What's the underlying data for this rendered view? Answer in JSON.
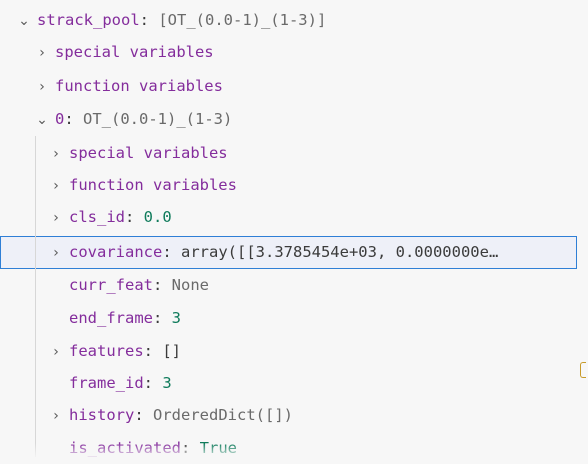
{
  "tree": {
    "root": {
      "name": "strack_pool",
      "value": "[OT_(0.0-1)_(1-3)]",
      "chevron": "chevron-down-icon"
    },
    "root_children": [
      {
        "label": "special variables",
        "chevron": "chevron-right-icon"
      },
      {
        "label": "function variables",
        "chevron": "chevron-right-icon"
      }
    ],
    "item0": {
      "name": "0",
      "value": "OT_(0.0-1)_(1-3)",
      "chevron": "chevron-down-icon"
    },
    "item0_children": [
      {
        "label": "special variables",
        "chevron": "chevron-right-icon"
      },
      {
        "label": "function variables",
        "chevron": "chevron-right-icon"
      },
      {
        "name": "cls_id",
        "value": "0.0",
        "kind": "number",
        "expandable": true
      },
      {
        "name": "covariance",
        "value": "array([[3.3785454e+03, 0.0000000e…",
        "kind": "plain",
        "expandable": true,
        "selected": true
      },
      {
        "name": "curr_feat",
        "value": "None",
        "kind": "string",
        "expandable": false
      },
      {
        "name": "end_frame",
        "value": "3",
        "kind": "number",
        "expandable": false
      },
      {
        "name": "features",
        "value": "[]",
        "kind": "plain",
        "expandable": true
      },
      {
        "name": "frame_id",
        "value": "3",
        "kind": "number",
        "expandable": false
      },
      {
        "name": "history",
        "value": "OrderedDict([])",
        "kind": "string",
        "expandable": true
      },
      {
        "name": "is_activated",
        "value": "True",
        "kind": "number",
        "expandable": false
      }
    ]
  },
  "colors": {
    "name": "#842d9c",
    "number": "#0f7b5b",
    "string": "#6a6a6a",
    "selection_border": "#2f7fd6",
    "selection_bg": "#eef0f8"
  }
}
